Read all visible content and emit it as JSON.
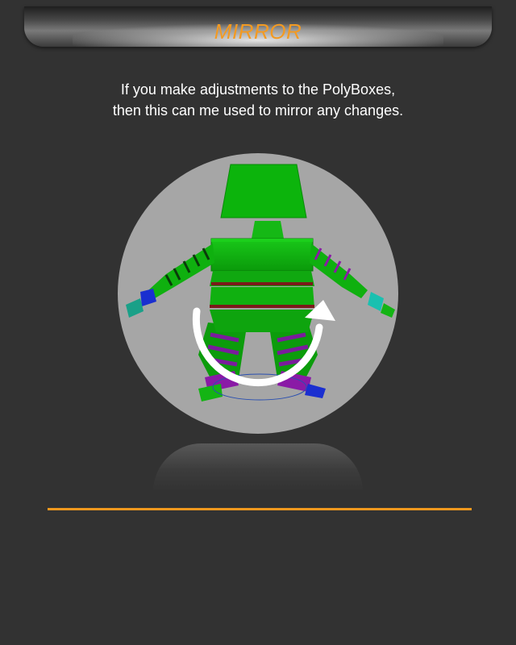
{
  "header": {
    "title": "MIRROR"
  },
  "caption": {
    "line1": "If you make adjustments to the PolyBoxes,",
    "line2": "then this can me used to mirror any changes."
  },
  "scene": {
    "icon": "mirror-rotate-arrow-icon"
  },
  "colors": {
    "title": "#f39a22",
    "divider": "#f0981e",
    "mesh_green": "#0cb40c",
    "mesh_purple": "#8a1aa6",
    "mesh_blue": "#1a2fd0"
  }
}
